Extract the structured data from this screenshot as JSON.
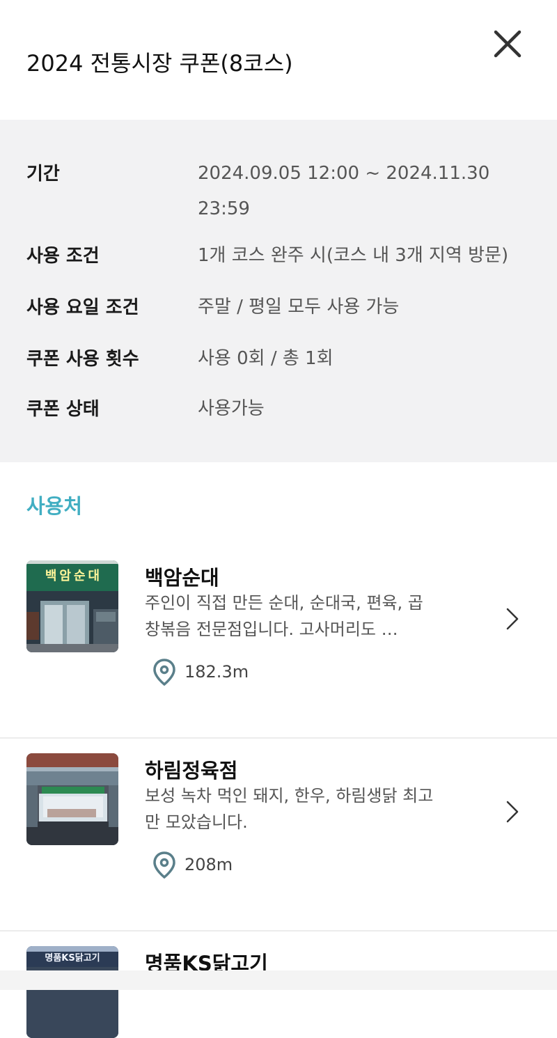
{
  "header": {
    "title": "2024 전통시장 쿠폰(8코스)"
  },
  "info": {
    "rows": [
      {
        "label": "기간",
        "value": "2024.09.05 12:00 ~ 2024.11.30 23:59"
      },
      {
        "label": "사용 조건",
        "value": "1개 코스 완주 시(코스 내 3개 지역 방문)"
      },
      {
        "label": "사용 요일 조건",
        "value": "주말 / 평일 모두 사용 가능"
      },
      {
        "label": "쿠폰 사용 횟수",
        "value": "사용 0회 / 총 1회"
      },
      {
        "label": "쿠폰 상태",
        "value": "사용가능"
      }
    ]
  },
  "section": {
    "title": "사용처"
  },
  "places": [
    {
      "name": "백암순대",
      "desc": "주인이 직접 만든 순대, 순대국, 편육, 곱창볶음 전문점입니다. 고사머리도 …",
      "distance": "182.3m",
      "sign_text": "백암순대"
    },
    {
      "name": "하림정육점",
      "desc": "보성 녹차 먹인 돼지, 한우, 하림생닭 최고만 모았습니다.",
      "distance": "208m"
    },
    {
      "name": "명품KS닭고기",
      "sign_text": "명품KS닭고기"
    }
  ],
  "colors": {
    "accent": "#41aec2",
    "info_bg": "#f2f2f3",
    "pin": "#5a7f8a"
  }
}
